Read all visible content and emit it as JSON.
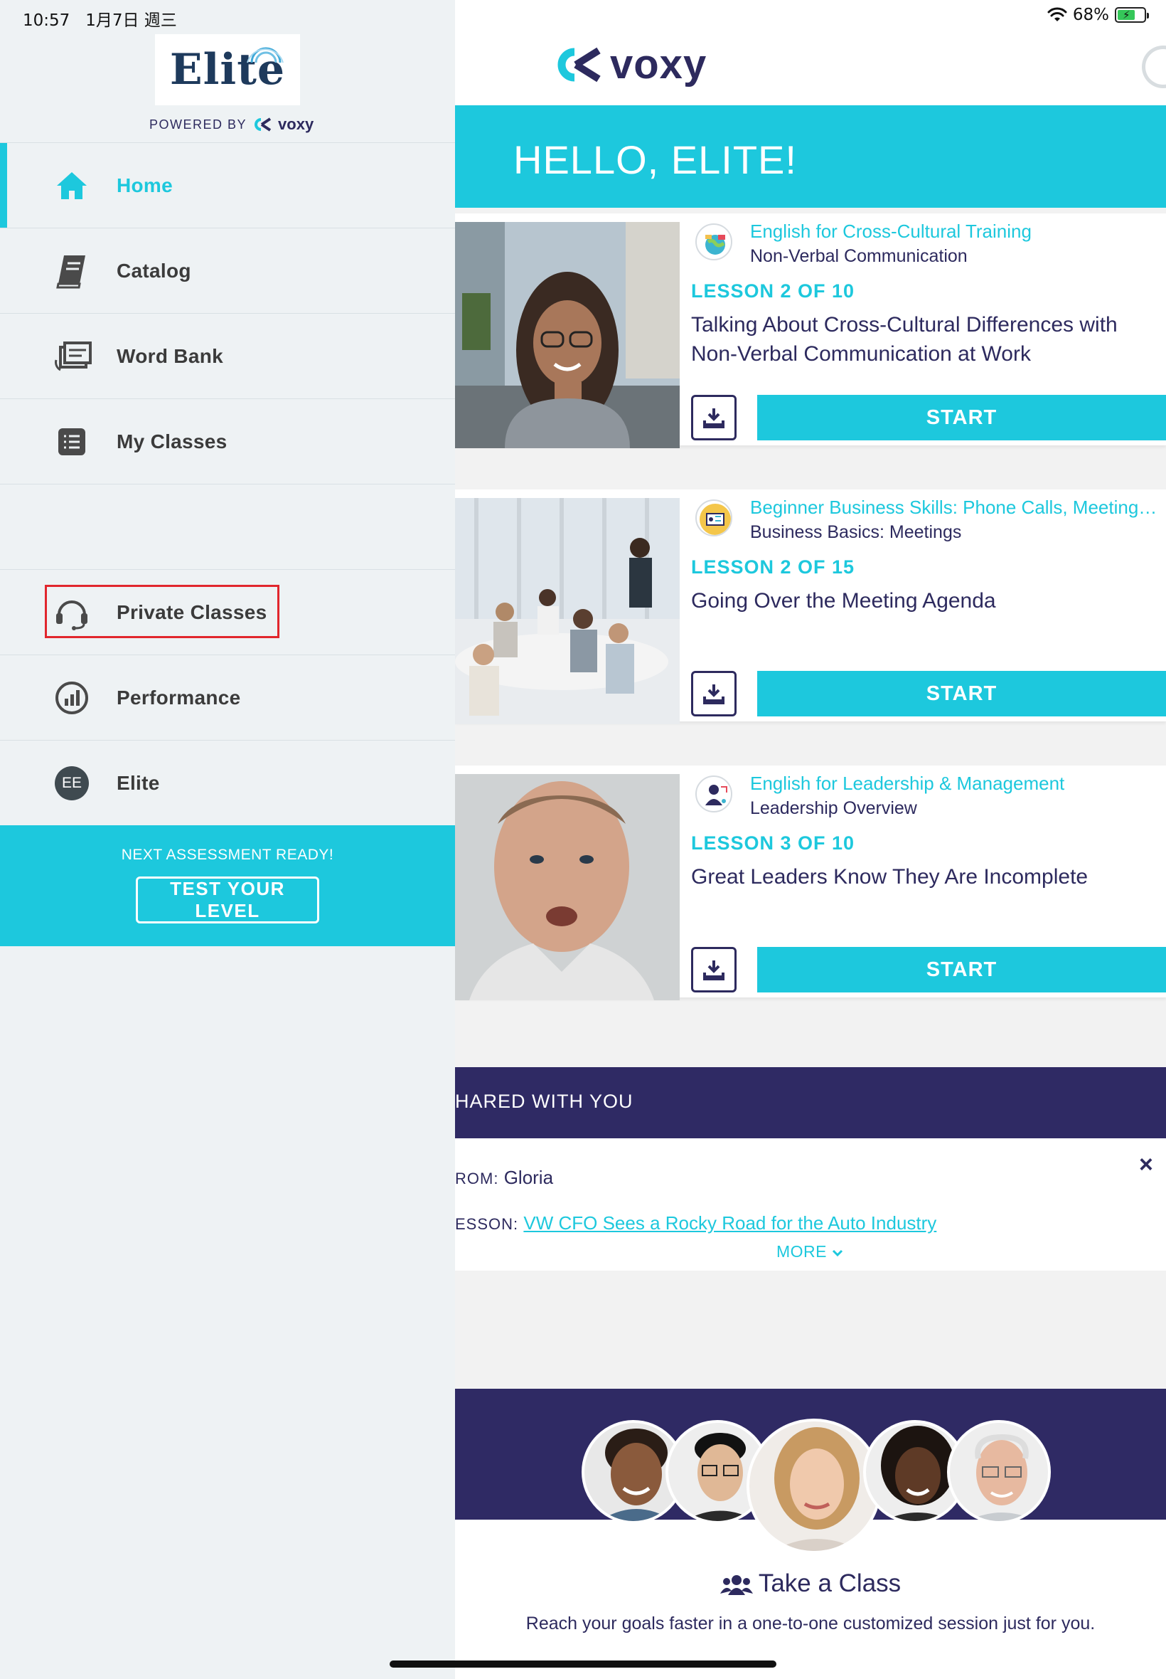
{
  "status_bar": {
    "time": "10:57",
    "date": "1月7日 週三",
    "battery": "68%"
  },
  "sidebar": {
    "logo_text": "Elite",
    "powered_by": "POWERED BY",
    "powered_brand": "voxy",
    "items": [
      {
        "label": "Home",
        "icon": "home-icon",
        "active": true
      },
      {
        "label": "Catalog",
        "icon": "book-icon"
      },
      {
        "label": "Word Bank",
        "icon": "word-bank-icon"
      },
      {
        "label": "My Classes",
        "icon": "list-icon"
      },
      {
        "label": "Private Classes",
        "icon": "headset-icon",
        "highlighted": true
      },
      {
        "label": "Performance",
        "icon": "performance-icon"
      },
      {
        "label": "Elite",
        "icon": "avatar-ee-icon",
        "avatar_text": "EE"
      }
    ],
    "assessment": {
      "text": "NEXT ASSESSMENT READY!",
      "button": "TEST YOUR LEVEL"
    }
  },
  "header": {
    "brand": "voxy"
  },
  "hello": "HELLO, ELITE!",
  "lessons": [
    {
      "course": "English for Cross-Cultural Training",
      "unit": "Non-Verbal Communication",
      "lesson_no": "LESSON 2 OF 10",
      "title": "Talking About Cross-Cultural Differences with Non-Verbal Communication at Work",
      "start": "START"
    },
    {
      "course": "Beginner Business Skills: Phone Calls, Meetings & Presentations",
      "unit": "Business Basics: Meetings",
      "lesson_no": "LESSON 2 OF 15",
      "title": "Going Over the Meeting Agenda",
      "start": "START"
    },
    {
      "course": "English for Leadership & Management",
      "unit": "Leadership Overview",
      "lesson_no": "LESSON 3 OF 10",
      "title": "Great Leaders Know They Are Incomplete",
      "start": "START"
    }
  ],
  "shared": {
    "heading": "HARED WITH YOU",
    "from_label": "ROM:",
    "from_value": "Gloria",
    "lesson_label": "ESSON:",
    "lesson_link": "VW CFO Sees a Rocky Road for the Auto Industry",
    "more": "MORE",
    "close": "×"
  },
  "take_class": {
    "title": "Take a Class",
    "description": "Reach your goals faster in a one-to-one customized session just for you."
  },
  "colors": {
    "accent": "#1dc8dd",
    "navy": "#2f2a64",
    "highlight": "#e1262d"
  }
}
